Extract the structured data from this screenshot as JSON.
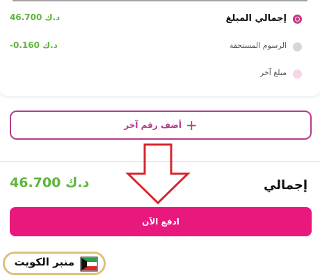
{
  "breakdown": {
    "items": [
      {
        "label": "إجمالي المبلغ",
        "amount": "46.700 د.ك",
        "state": "selected"
      },
      {
        "label": "الرسوم المستحقة",
        "amount": "-0.160 د.ك",
        "state": "unselected"
      },
      {
        "label": "مبلغ آخر",
        "amount": "",
        "state": "unselected"
      }
    ]
  },
  "add_number": {
    "label": "أضف رقم آخر",
    "icon": "plus-icon"
  },
  "total": {
    "label": "إجمالي",
    "amount": "46.700 د.ك"
  },
  "pay": {
    "label": "ادفع الآن"
  },
  "watermark": {
    "text": "منبر الكويت"
  },
  "colors": {
    "accent_magenta": "#e8187c",
    "outline_purple": "#b43a8a",
    "amount_green": "#5fb53d",
    "annotation_red": "#d8262c",
    "logo_gold": "#d9c27a"
  }
}
